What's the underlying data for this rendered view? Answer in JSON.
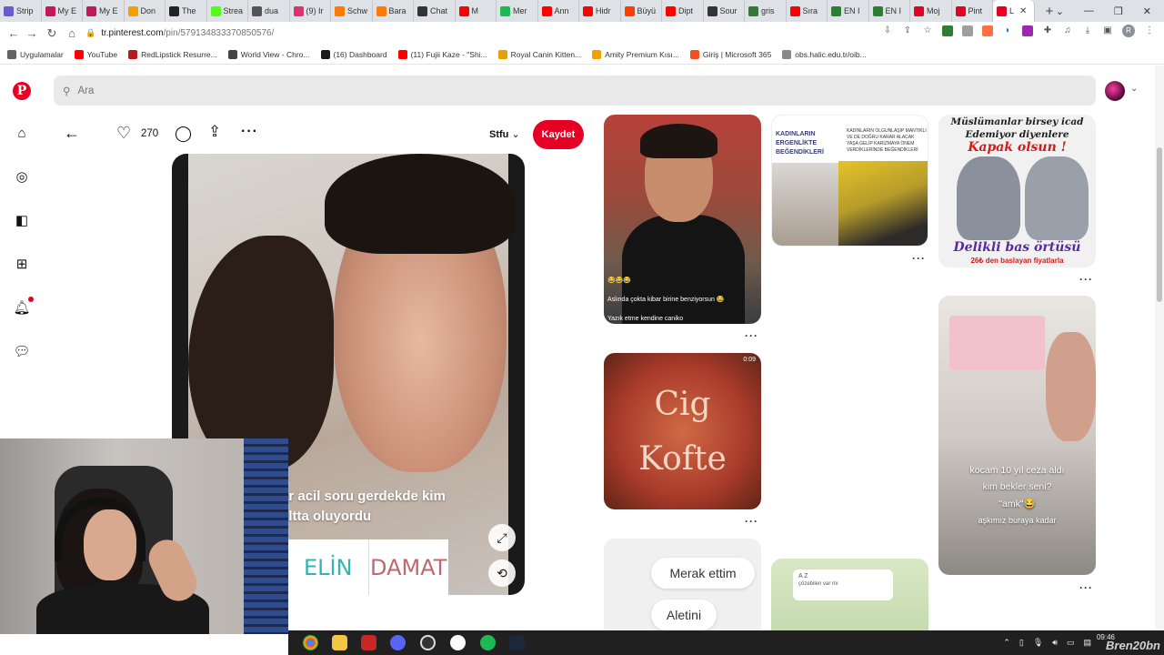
{
  "browser": {
    "tabs": [
      {
        "label": "Strip",
        "color": "#6a5acd"
      },
      {
        "label": "My E",
        "color": "#c2185b"
      },
      {
        "label": "My E",
        "color": "#c2185b"
      },
      {
        "label": "Don",
        "color": "#f4a100"
      },
      {
        "label": "The",
        "color": "#222222"
      },
      {
        "label": "Strea",
        "color": "#53fc18"
      },
      {
        "label": "dua",
        "color": "#555555"
      },
      {
        "label": "(9) Ir",
        "color": "#e1306c"
      },
      {
        "label": "Schw",
        "color": "#ff7a00"
      },
      {
        "label": "Bara",
        "color": "#ff7a00"
      },
      {
        "label": "Chat",
        "color": "#333333"
      },
      {
        "label": "M",
        "color": "#ff0000"
      },
      {
        "label": "Mer",
        "color": "#1db954"
      },
      {
        "label": "Ann",
        "color": "#ff0000"
      },
      {
        "label": "Hidr",
        "color": "#ff0000"
      },
      {
        "label": "Büyü",
        "color": "#ff3d00"
      },
      {
        "label": "Dipt",
        "color": "#ff0000"
      },
      {
        "label": "Sour",
        "color": "#333333"
      },
      {
        "label": "gris",
        "color": "#2e7d32"
      },
      {
        "label": "Sıra",
        "color": "#ff0000"
      },
      {
        "label": "EN I",
        "color": "#2e7d32"
      },
      {
        "label": "EN I",
        "color": "#2e7d32"
      },
      {
        "label": "Moj",
        "color": "#e60023"
      },
      {
        "label": "Pint",
        "color": "#e60023"
      },
      {
        "label": "L",
        "color": "#e60023",
        "active": true
      }
    ],
    "new_tab": "+",
    "window_controls": [
      "⌄",
      "—",
      "❐",
      "✕"
    ],
    "url_host": "tr.pinterest.com",
    "url_path": "/pin/579134833370850576/",
    "profile_initial": "R",
    "bookmarks": [
      {
        "label": "Uygulamalar",
        "color": "#5f6368"
      },
      {
        "label": "YouTube",
        "color": "#ff0000"
      },
      {
        "label": "RedLipstick Resurre...",
        "color": "#b71c1c"
      },
      {
        "label": "World View - Chro...",
        "color": "#444444"
      },
      {
        "label": "(16) Dashboard",
        "color": "#1a1a1a"
      },
      {
        "label": "(11) Fujii Kaze - \"Shi...",
        "color": "#ff0000"
      },
      {
        "label": "Royal Canin Kitten...",
        "color": "#e6a100"
      },
      {
        "label": "Amity Premium Kısı...",
        "color": "#f4a100"
      },
      {
        "label": "Giriş | Microsoft 365",
        "color": "#f25022"
      },
      {
        "label": "obs.halic.edu.tr/oib...",
        "color": "#888888"
      }
    ]
  },
  "pinterest": {
    "search_placeholder": "Ara",
    "pin": {
      "like_count": "270",
      "board_name": "Stfu",
      "save_label": "Kaydet",
      "caption_line1": "ar acil soru gerdekde kim",
      "caption_line2": "altta oluyordu",
      "choice_left": "ELİN",
      "choice_right": "DAMAT"
    },
    "related": {
      "pin1_lines": [
        "😂😂😂",
        "Aslında çokta kibar birine benziyorsun 😂",
        "Yazık etme kendine caniko"
      ],
      "pin2_header": "KADINLARIN ERGENLİKTE BEĞENDİKLERİ",
      "pin2_sub": "KADINLARIN OLGUNLAŞIP MANTIKLI VE DE DOĞRU KARAR ALACAK YAŞA GELİP KARİZMAYA ÖNEM VERDİKLERİNDE BEĞENDİKLERİ",
      "pin3_line1": "Müslümanlar birsey icad Edemiyor diyenlere",
      "pin3_line2": "Kapak olsun !",
      "pin3_line3": "Delikli bas örtüsü",
      "pin3_line4": "26₺ den baslayan fiyatlarla",
      "pin4_line1": "Cig",
      "pin4_line2": "Kofte",
      "pin4_time": "0:09",
      "pin5_line1": "kocam 10 yıl ceza aldı",
      "pin5_line2": "kim bekler seni?",
      "pin5_line3": "\"amk\"😂",
      "pin5_line4": "aşkımız buraya kadar",
      "pin6_bubble1": "Merak ettim",
      "pin6_bubble2": "Aletini",
      "pin7_label": "A Z",
      "pin7_msg": "çözebilen var mı"
    }
  },
  "taskbar": {
    "time": "09:46",
    "watermark": "Bren20bn"
  }
}
